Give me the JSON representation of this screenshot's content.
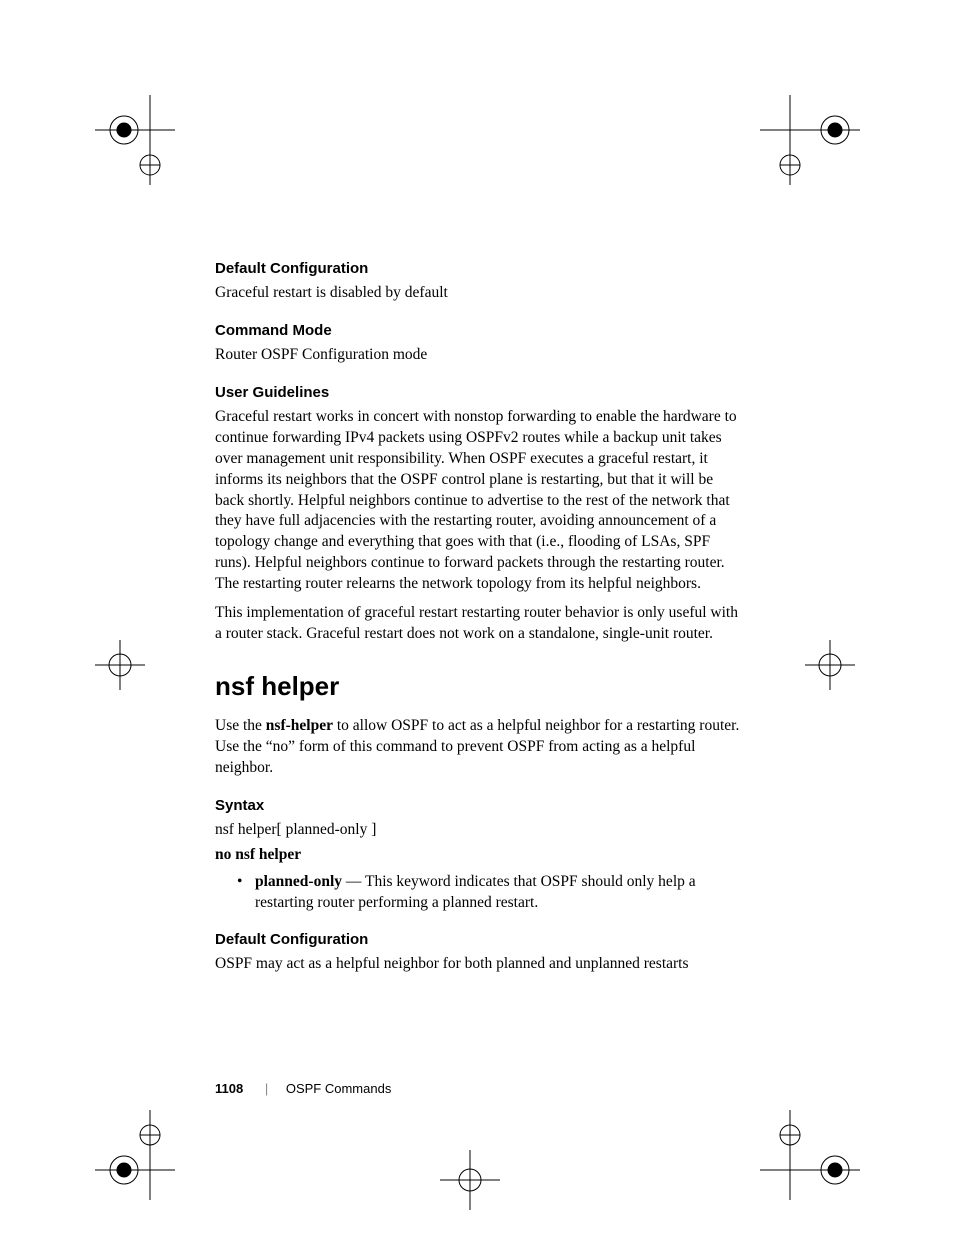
{
  "sections": {
    "default_config_1": {
      "heading": "Default Configuration",
      "body": "Graceful restart is disabled by default"
    },
    "command_mode": {
      "heading": "Command Mode",
      "body": "Router OSPF Configuration mode"
    },
    "user_guidelines": {
      "heading": "User Guidelines",
      "p1": "Graceful restart works in concert with nonstop forwarding to enable the hardware to continue forwarding IPv4 packets using OSPFv2 routes while a backup unit takes over management unit responsibility. When OSPF executes a graceful restart, it informs its neighbors that the OSPF control plane is restarting, but that it will be back shortly. Helpful neighbors continue to advertise to the rest of the network that they have full adjacencies with the restarting router, avoiding announcement of a topology change and everything that goes with that (i.e., flooding of LSAs, SPF runs). Helpful neighbors continue to forward packets through the restarting router. The restarting router relearns the network topology from its helpful neighbors.",
      "p2": "This implementation of graceful restart restarting router behavior is only useful with a router stack. Graceful restart does not work on a standalone, single-unit router."
    },
    "nsf_helper": {
      "heading": "nsf helper",
      "intro_pre": "Use the ",
      "intro_bold": "nsf-helper",
      "intro_post": " to allow OSPF to act as a helpful neighbor for a restarting router.  Use the “no” form of this command to prevent OSPF from acting as a helpful neighbor."
    },
    "syntax": {
      "heading": "Syntax",
      "line1": "nsf helper[ planned-only ]",
      "line2": "no nsf helper",
      "bullet_bold": "planned-only",
      "bullet_rest": " — This keyword indicates that OSPF should only help a restarting router performing a planned restart."
    },
    "default_config_2": {
      "heading": "Default Configuration",
      "body": "OSPF may act as a helpful neighbor for both planned and unplanned restarts"
    }
  },
  "footer": {
    "page_number": "1108",
    "separator": "|",
    "title": "OSPF Commands"
  }
}
